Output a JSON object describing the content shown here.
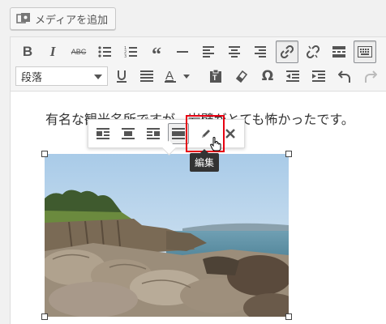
{
  "add_media": {
    "label": "メディアを追加",
    "icon": "media-icon"
  },
  "toolbar": {
    "row1": [
      {
        "name": "bold-button",
        "icon": "bold-icon",
        "text": "B"
      },
      {
        "name": "italic-button",
        "icon": "italic-icon",
        "text": "I"
      },
      {
        "name": "strikethrough-button",
        "icon": "strikethrough-icon",
        "text": "ABC"
      },
      {
        "name": "bullet-list-button",
        "icon": "bullet-list-icon"
      },
      {
        "name": "numbered-list-button",
        "icon": "numbered-list-icon"
      },
      {
        "name": "blockquote-button",
        "icon": "quote-icon"
      },
      {
        "name": "horizontal-rule-button",
        "icon": "horizontal-rule-icon"
      },
      {
        "name": "align-left-button",
        "icon": "align-left-icon"
      },
      {
        "name": "align-center-button",
        "icon": "align-center-icon"
      },
      {
        "name": "align-right-button",
        "icon": "align-right-icon"
      },
      {
        "name": "insert-link-button",
        "icon": "link-icon",
        "active": true
      },
      {
        "name": "remove-link-button",
        "icon": "unlink-icon"
      },
      {
        "name": "read-more-button",
        "icon": "read-more-icon"
      },
      {
        "name": "toolbar-toggle-button",
        "icon": "keyboard-icon",
        "active": true
      }
    ],
    "format_select": {
      "value": "段落"
    },
    "row2": [
      {
        "name": "underline-button",
        "icon": "underline-icon"
      },
      {
        "name": "justify-button",
        "icon": "justify-icon"
      },
      {
        "name": "text-color-button",
        "icon": "text-color-icon"
      },
      {
        "name": "paste-as-text-button",
        "icon": "clipboard-icon"
      },
      {
        "name": "clear-formatting-button",
        "icon": "eraser-icon"
      },
      {
        "name": "special-character-button",
        "icon": "omega-icon"
      },
      {
        "name": "outdent-button",
        "icon": "outdent-icon"
      },
      {
        "name": "indent-button",
        "icon": "indent-icon"
      },
      {
        "name": "undo-button",
        "icon": "undo-icon"
      },
      {
        "name": "redo-button",
        "icon": "redo-icon"
      }
    ]
  },
  "content": {
    "paragraph": "有名な観光名所ですが、岩壁がとても怖かったです。"
  },
  "image_toolbar": {
    "buttons": [
      {
        "name": "image-align-left-button",
        "icon": "align-left-icon"
      },
      {
        "name": "image-align-center-button",
        "icon": "align-center-icon"
      },
      {
        "name": "image-align-right-button",
        "icon": "align-right-icon"
      },
      {
        "name": "image-align-none-button",
        "icon": "align-none-icon",
        "active": true
      },
      {
        "name": "image-edit-button",
        "icon": "pencil-icon"
      },
      {
        "name": "image-remove-button",
        "icon": "close-icon"
      }
    ],
    "tooltip": "編集"
  },
  "colors": {
    "highlight": "#e60012",
    "icon": "#555555"
  }
}
